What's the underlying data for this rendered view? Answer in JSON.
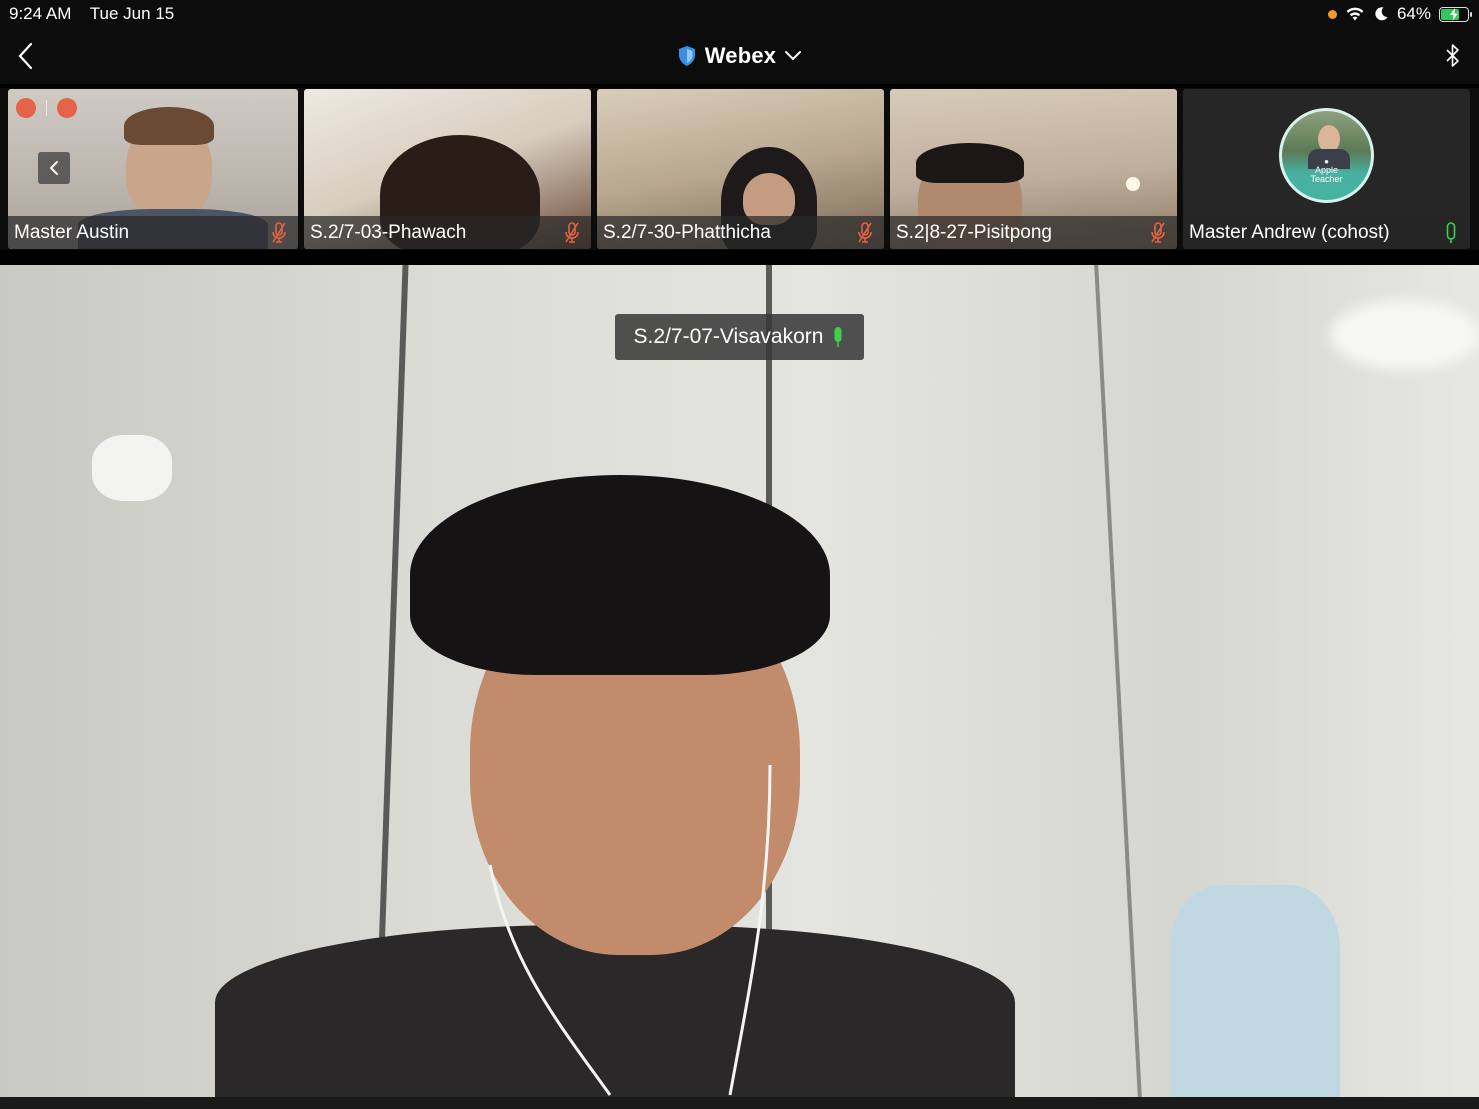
{
  "status_bar": {
    "time": "9:24 AM",
    "date": "Tue Jun 15",
    "battery": "64%",
    "battery_level": 0.64,
    "icons": [
      "orange-dot-indicator",
      "wifi-icon",
      "moon-icon",
      "battery-charging-icon"
    ]
  },
  "nav": {
    "title": "Webex",
    "icons": [
      "back-chevron-icon",
      "shield-icon",
      "chevron-down-icon",
      "bluetooth-icon"
    ]
  },
  "participants": [
    {
      "name": "Master Austin",
      "mic": "muted",
      "mic_color": "#e8623f"
    },
    {
      "name": "S.2/7-03-Phawach",
      "mic": "muted",
      "mic_color": "#e8623f"
    },
    {
      "name": "S.2/7-30-Phatthicha",
      "mic": "muted",
      "mic_color": "#e8623f"
    },
    {
      "name": "S.2|8-27-Pisitpong",
      "mic": "muted",
      "mic_color": "#e8623f"
    },
    {
      "name": "Master Andrew (cohost)",
      "mic": "unmuted",
      "mic_color": "#3ecf4f",
      "avatar_text": [
        "Apple",
        "Teacher"
      ]
    }
  ],
  "active_speaker": {
    "name": "S.2/7-07-Visavakorn",
    "mic": "active",
    "mic_color": "#3ecf4f"
  },
  "colors": {
    "background": "#0c0c0c",
    "muted_mic": "#e8623f",
    "active_mic": "#3ecf4f",
    "recording": "#e8583c"
  }
}
